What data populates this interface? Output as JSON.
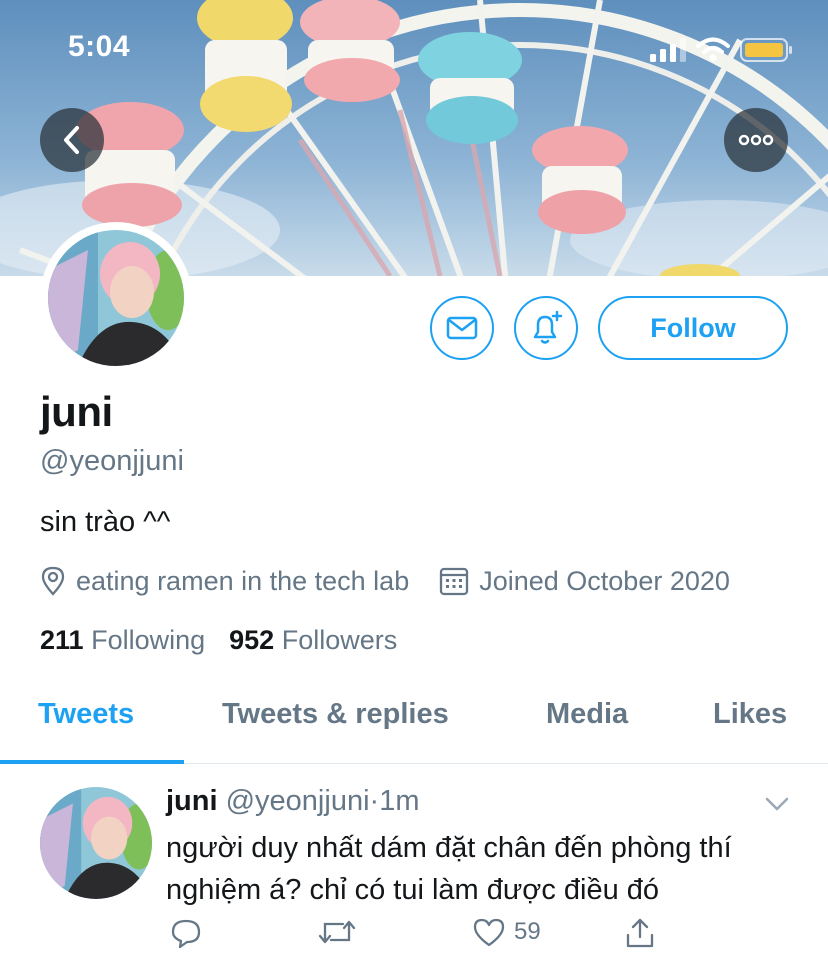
{
  "status_bar": {
    "time": "5:04"
  },
  "header": {
    "back_icon": "chevron-left-icon",
    "more_icon": "more-horizontal-icon"
  },
  "profile": {
    "display_name": "juni",
    "handle": "@yeonjjuni",
    "bio": "sin trào ^^",
    "location": "eating ramen in the tech lab",
    "joined": "Joined October 2020",
    "following_count": "211",
    "following_label": "Following",
    "followers_count": "952",
    "followers_label": "Followers",
    "follow_label": "Follow"
  },
  "tabs": [
    {
      "label": "Tweets",
      "active": true
    },
    {
      "label": "Tweets & replies",
      "active": false
    },
    {
      "label": "Media",
      "active": false
    },
    {
      "label": "Likes",
      "active": false
    }
  ],
  "tweet": {
    "name": "juni",
    "handle": "@yeonjjuni",
    "time": "·1m",
    "text": "người duy nhất dám đặt chân đến phòng thí nghiệm á? chỉ có tui làm được điều đó",
    "like_count": "59"
  },
  "colors": {
    "accent": "#1da1f2",
    "secondary_text": "#657786",
    "primary_text": "#14171a"
  }
}
